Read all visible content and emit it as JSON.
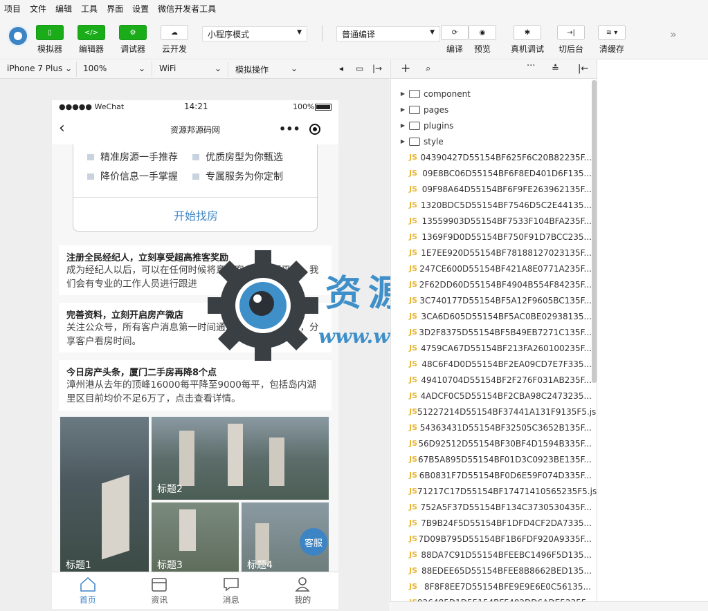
{
  "menu": [
    "项目",
    "文件",
    "编辑",
    "工具",
    "界面",
    "设置",
    "微信开发者工具"
  ],
  "toolbar": {
    "simulator": "模拟器",
    "editor": "编辑器",
    "debugger": "调试器",
    "cloud": "云开发",
    "mode": "小程序模式",
    "compile_mode": "普通编译",
    "compile": "编译",
    "preview": "预览",
    "remote_debug": "真机调试",
    "background": "切后台",
    "clear_cache": "清缓存"
  },
  "devbar": {
    "device": "iPhone 7 Plus",
    "zoom": "100%",
    "network": "WiFi",
    "operation": "模拟操作"
  },
  "phone": {
    "carrier": "●●●●● WeChat",
    "time": "14:21",
    "battery": "100%",
    "title": "资源邦源码网",
    "features": [
      "精准房源一手推荐",
      "优质房型为你甄选",
      "降价信息一手掌握",
      "专属服务为你定制"
    ],
    "start_button": "开始找房",
    "news": [
      {
        "title": "注册全民经纪人，立刻享受超高推客奖励",
        "desc": "成为经纪人以后，可以在任何时候将意向客户推荐至平台，我们会有专业的工作人员进行跟进"
      },
      {
        "title": "完善资料，立刻开启房产微店",
        "desc": "关注公众号，所有客户消息第一时间通知到位，每日算盘，分享客户看房时间。"
      },
      {
        "title": "今日房产头条，厦门二手房再降8个点",
        "desc": "漳州港从去年的顶峰16000每平降至9000每平，包括岛内湖里区目前均价不足6万了，点击查看详情。"
      }
    ],
    "images": [
      "标题1",
      "标题2",
      "标题3",
      "标题4"
    ],
    "service": "客服",
    "tabs": [
      "首页",
      "资讯",
      "消息",
      "我的"
    ]
  },
  "watermark": {
    "cn": "资源邦",
    "url": "www.wazyb.com"
  },
  "files": {
    "folders": [
      "component",
      "pages",
      "plugins",
      "style"
    ],
    "js": [
      "04390427D55154BF625F6C20B82235F...",
      "09E8BC06D55154BF6F8ED401D6F135...",
      "09F98A64D55154BF6F9FE263962135F...",
      "1320BDC5D55154BF7546D5C2E44135...",
      "13559903D55154BF7533F104BFA235F...",
      "1369F9D0D55154BF750F91D7BCC235...",
      "1E7EE920D55154BF78188127023135F...",
      "247CE600D55154BF421A8E0771A235F...",
      "2F62DD60D55154BF4904B554F84235F...",
      "3C740177D55154BF5A12F9605BC135F...",
      "3CA6D605D55154BF5AC0BE02938135...",
      "3D2F8375D55154BF5B49EB7271C135F...",
      "4759CA67D55154BF213FA260100235F...",
      "48C6F4D0D55154BF2EA09CD7E7F335...",
      "49410704D55154BF2F276F031AB235F...",
      "4ADCF0C5D55154BF2CBA98C2473235...",
      "51227214D55154BF37441A131F9135F5.js",
      "54363431D55154BF32505C3652B135F...",
      "56D92512D55154BF30BF4D1594B335F...",
      "67B5A895D55154BF01D3C0923BE135F...",
      "6B0831F7D55154BF0D6E59F074D335F...",
      "71217C17D55154BF17471410565235F5.js",
      "752A5F37D55154BF134C3730530435F...",
      "7B9B24F5D55154BF1DFD4CF2DA7335...",
      "7D09B795D55154BF1B6FDF920A9335F...",
      "88DA7C91D55154BFEEBC1496F5D135...",
      "88EDEE65D55154BFEE8B8662BED135...",
      "8F8F8EE7D55154BFE9E9E6E0C56135...",
      "926485D1D55154BFF402DD6ADE5235F..."
    ]
  },
  "colors": {
    "accent": "#3d84c4",
    "green": "#1aad19"
  }
}
